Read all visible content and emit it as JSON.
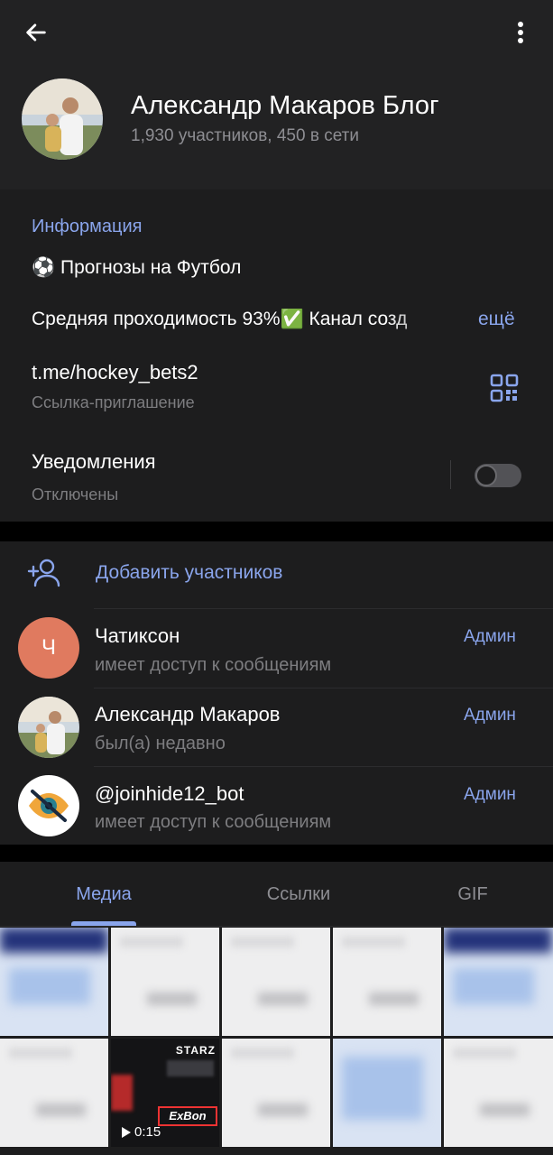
{
  "header": {
    "title": "Александр Макаров Блог",
    "subtitle": "1,930 участников, 450 в сети",
    "back_icon": "arrow-left-icon",
    "menu_icon": "more-vertical-icon"
  },
  "info": {
    "section_title": "Информация",
    "about_line1": "⚽️ Прогнозы на Футбол",
    "about_line2": "Средняя проходимость 93%✅ Канал созд",
    "more_label": "ещё",
    "link": "t.me/hockey_bets2",
    "link_caption": "Ссылка-приглашение",
    "qr_icon": "qr-code-icon",
    "notifications_title": "Уведомления",
    "notifications_status": "Отключены",
    "notifications_enabled": false
  },
  "members": {
    "add_label": "Добавить участников",
    "list": [
      {
        "initial": "Ч",
        "name": "Чатиксон",
        "status": "имеет доступ к сообщениям",
        "role": "Админ",
        "avatar_color": "#e07a5f"
      },
      {
        "name": "Александр Макаров",
        "status": "был(а) недавно",
        "role": "Админ"
      },
      {
        "name": "@joinhide12_bot",
        "status": "имеет доступ к сообщениям",
        "role": "Админ"
      }
    ]
  },
  "media": {
    "tabs": [
      "Медиа",
      "Ссылки",
      "GIF"
    ],
    "active_tab": 0,
    "video_title": "STARZ",
    "video_logo": "ExBon",
    "video_duration": "0:15"
  },
  "colors": {
    "accent": "#8aa5ec",
    "background": "#1d1d1e",
    "header": "#222223"
  }
}
